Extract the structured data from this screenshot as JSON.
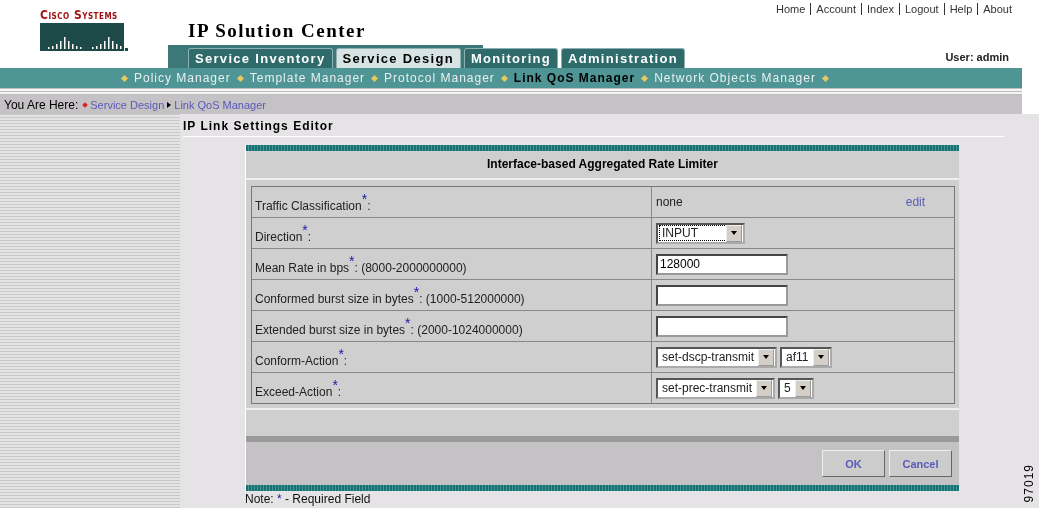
{
  "header": {
    "logo": "Cisco Systems",
    "title": "IP Solution Center",
    "links": [
      "Home",
      "Account",
      "Index",
      "Logout",
      "Help",
      "About"
    ],
    "user": "User: admin"
  },
  "tabs": [
    {
      "label": "Service Inventory",
      "selected": false
    },
    {
      "label": "Service Design",
      "selected": true
    },
    {
      "label": "Monitoring",
      "selected": false
    },
    {
      "label": "Administration",
      "selected": false
    }
  ],
  "subnav": [
    {
      "label": "Policy Manager",
      "selected": false
    },
    {
      "label": "Template Manager",
      "selected": false
    },
    {
      "label": "Protocol Manager",
      "selected": false
    },
    {
      "label": "Link QoS Manager",
      "selected": true
    },
    {
      "label": "Network Objects Manager",
      "selected": false
    }
  ],
  "breadcrumb": {
    "label": "You Are Here:",
    "items": [
      "Service Design",
      "Link QoS Manager"
    ]
  },
  "page_title": "IP Link Settings Editor",
  "form": {
    "title": "Interface-based Aggregated Rate Limiter",
    "rows": [
      {
        "kind": "text",
        "label": "Traffic Classification$^{*}$:",
        "value": "none",
        "link": "edit"
      },
      {
        "kind": "select",
        "label": "Direction$^{*}$:",
        "selects": [
          {
            "value": "INPUT",
            "focused": true
          }
        ]
      },
      {
        "kind": "input",
        "label": "Mean Rate in bps$^{*}$: (8000-2000000000)",
        "value": "128000"
      },
      {
        "kind": "input",
        "label": "Conformed burst size in bytes$^{*}$: (1000-512000000)"
      },
      {
        "kind": "input",
        "label": "Extended burst size in bytes$^{*}$: (2000-1024000000)"
      },
      {
        "kind": "select",
        "label": "Conform-Action$^{*}$:",
        "selects": [
          {
            "value": "set-dscp-transmit",
            "focused": false
          },
          {
            "value": "af11",
            "focused": false
          }
        ]
      },
      {
        "kind": "select",
        "label": "Exceed-Action$^{*}$:",
        "selects": [
          {
            "value": "set-prec-transmit",
            "focused": false
          },
          {
            "value": "5",
            "focused": false
          }
        ]
      }
    ],
    "buttons": [
      "OK",
      "Cancel"
    ]
  },
  "note": {
    "label": "Note:",
    "mark": "*",
    "text": "- Required Field"
  },
  "figure_number": "97019"
}
